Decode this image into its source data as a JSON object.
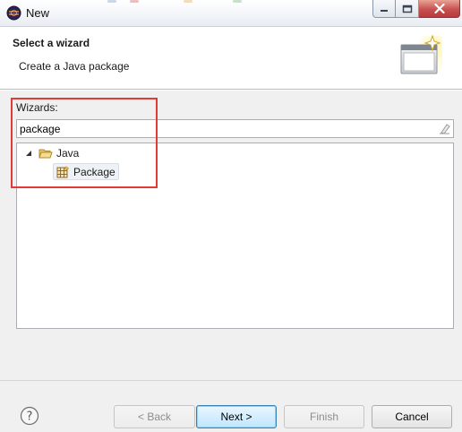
{
  "window": {
    "title": "New",
    "icon": "eclipse-icon",
    "controls": [
      "minimize-icon",
      "maximize-icon",
      "close-icon"
    ]
  },
  "banner": {
    "title": "Select a wizard",
    "description": "Create a Java package",
    "image": "wizard-banner-icon"
  },
  "wizards": {
    "label": "Wizards:",
    "filter_value": "package",
    "filter_clear_icon": "eraser-icon",
    "tree": [
      {
        "label": "Java",
        "icon": "open-folder-icon",
        "expanded": true,
        "children": [
          {
            "label": "Package",
            "icon": "package-icon",
            "selected": true
          }
        ]
      }
    ]
  },
  "footer": {
    "help_icon": "help-icon",
    "back_label": "< Back",
    "next_label": "Next >",
    "finish_label": "Finish",
    "cancel_label": "Cancel"
  },
  "colors": {
    "highlight_box": "#e23a3a",
    "default_button_border": "#3c7fb1",
    "dialog_background": "#f0f0f0"
  }
}
